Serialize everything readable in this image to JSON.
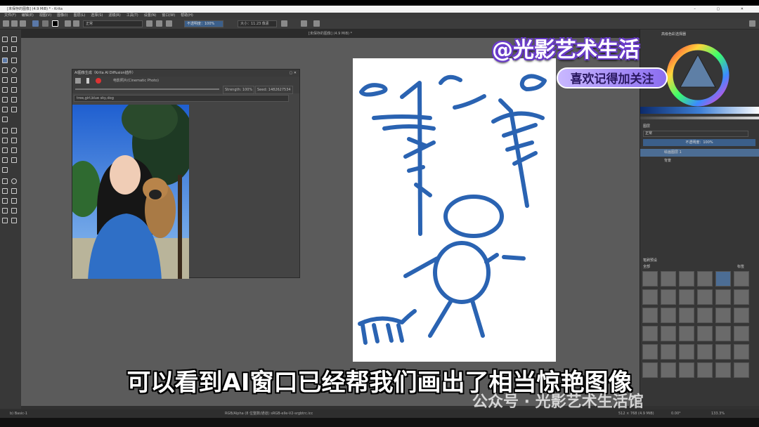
{
  "window": {
    "title": "[未保存的图像] (4.9 MiB) * - Krita",
    "tab_title": "[未保存的图像] (4.9 MiB) *"
  },
  "menu": [
    "文件(F)",
    "编辑(E)",
    "视图(V)",
    "图像(I)",
    "图层(L)",
    "选择(S)",
    "滤镜(R)",
    "工具(T)",
    "设置(N)",
    "窗口(W)",
    "帮助(H)"
  ],
  "toolbar": {
    "blend_mode": "正常",
    "opacity": "不透明度：100%",
    "size": "大小：11.23 像素"
  },
  "ai_window": {
    "title": "AI图像生成（Krita AI Diffusion插件）",
    "style": "电影照片(Cinematic Photo)",
    "strength": "Strength: 100%",
    "seed": "Seed: 1482627534",
    "prompt": "tree,girl,blue sky,dog"
  },
  "right_panel": {
    "color_selector_title": "高级色彩选择器",
    "layers_title": "图层",
    "blend_mode": "正常",
    "opacity": "不透明度：100%",
    "layers": [
      {
        "name": "绘画图层 1"
      },
      {
        "name": "背景"
      }
    ],
    "brushes_title": "笔刷预设",
    "brushes_filter": "全部",
    "brushes_tag": "标签"
  },
  "status": {
    "brush": "b) Basic-1",
    "color_info": "RGB/Alpha (8 位整数/通道)  sRGB-elle-V2-srgbtrc.icc",
    "dimensions": "512 × 768 (4.9 MiB)",
    "rotation": "0.00°",
    "zoom": "133.3%"
  },
  "overlay": {
    "brand": "@光影艺术生活",
    "follow": "喜欢记得加关注",
    "subtitle": "可以看到AI窗口已经帮我们画出了相当惊艳图像",
    "wechat": "公众号 · 光影艺术生活馆"
  },
  "colors": {
    "sketch_stroke": "#2a63b2",
    "panel_bg": "#363636",
    "canvas_bg": "#5b5b5b",
    "brand_outline": "#6a3cc9"
  }
}
